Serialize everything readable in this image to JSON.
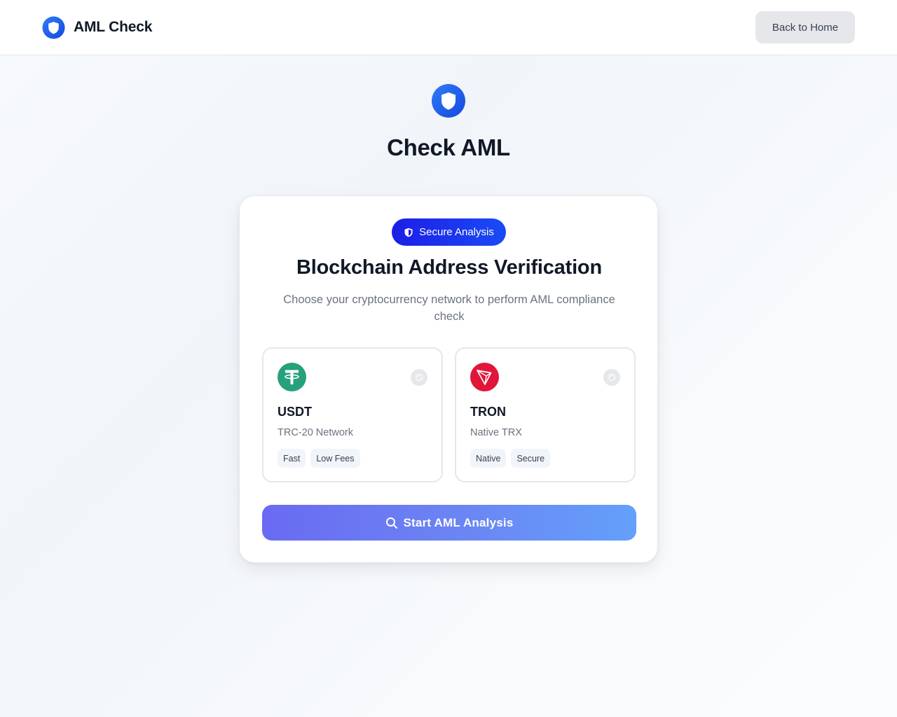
{
  "header": {
    "brand_name": "AML Check",
    "back_button_label": "Back to Home"
  },
  "hero": {
    "title": "Check AML"
  },
  "card": {
    "badge_label": "Secure Analysis",
    "title": "Blockchain Address Verification",
    "subtitle": "Choose your cryptocurrency network to perform AML compliance check",
    "networks": [
      {
        "name": "USDT",
        "description": "TRC-20 Network",
        "tags": [
          "Fast",
          "Low Fees"
        ],
        "icon": "tether-icon",
        "color": "#26a17b"
      },
      {
        "name": "TRON",
        "description": "Native TRX",
        "tags": [
          "Native",
          "Secure"
        ],
        "icon": "tron-icon",
        "color": "#e0163a"
      }
    ],
    "start_button_label": "Start AML Analysis"
  },
  "colors": {
    "accent_blue": "#1d4ef5",
    "badge_blue": "#1d1ee6",
    "button_gradient_start": "#6a6af2",
    "button_gradient_end": "#63a0fb"
  }
}
